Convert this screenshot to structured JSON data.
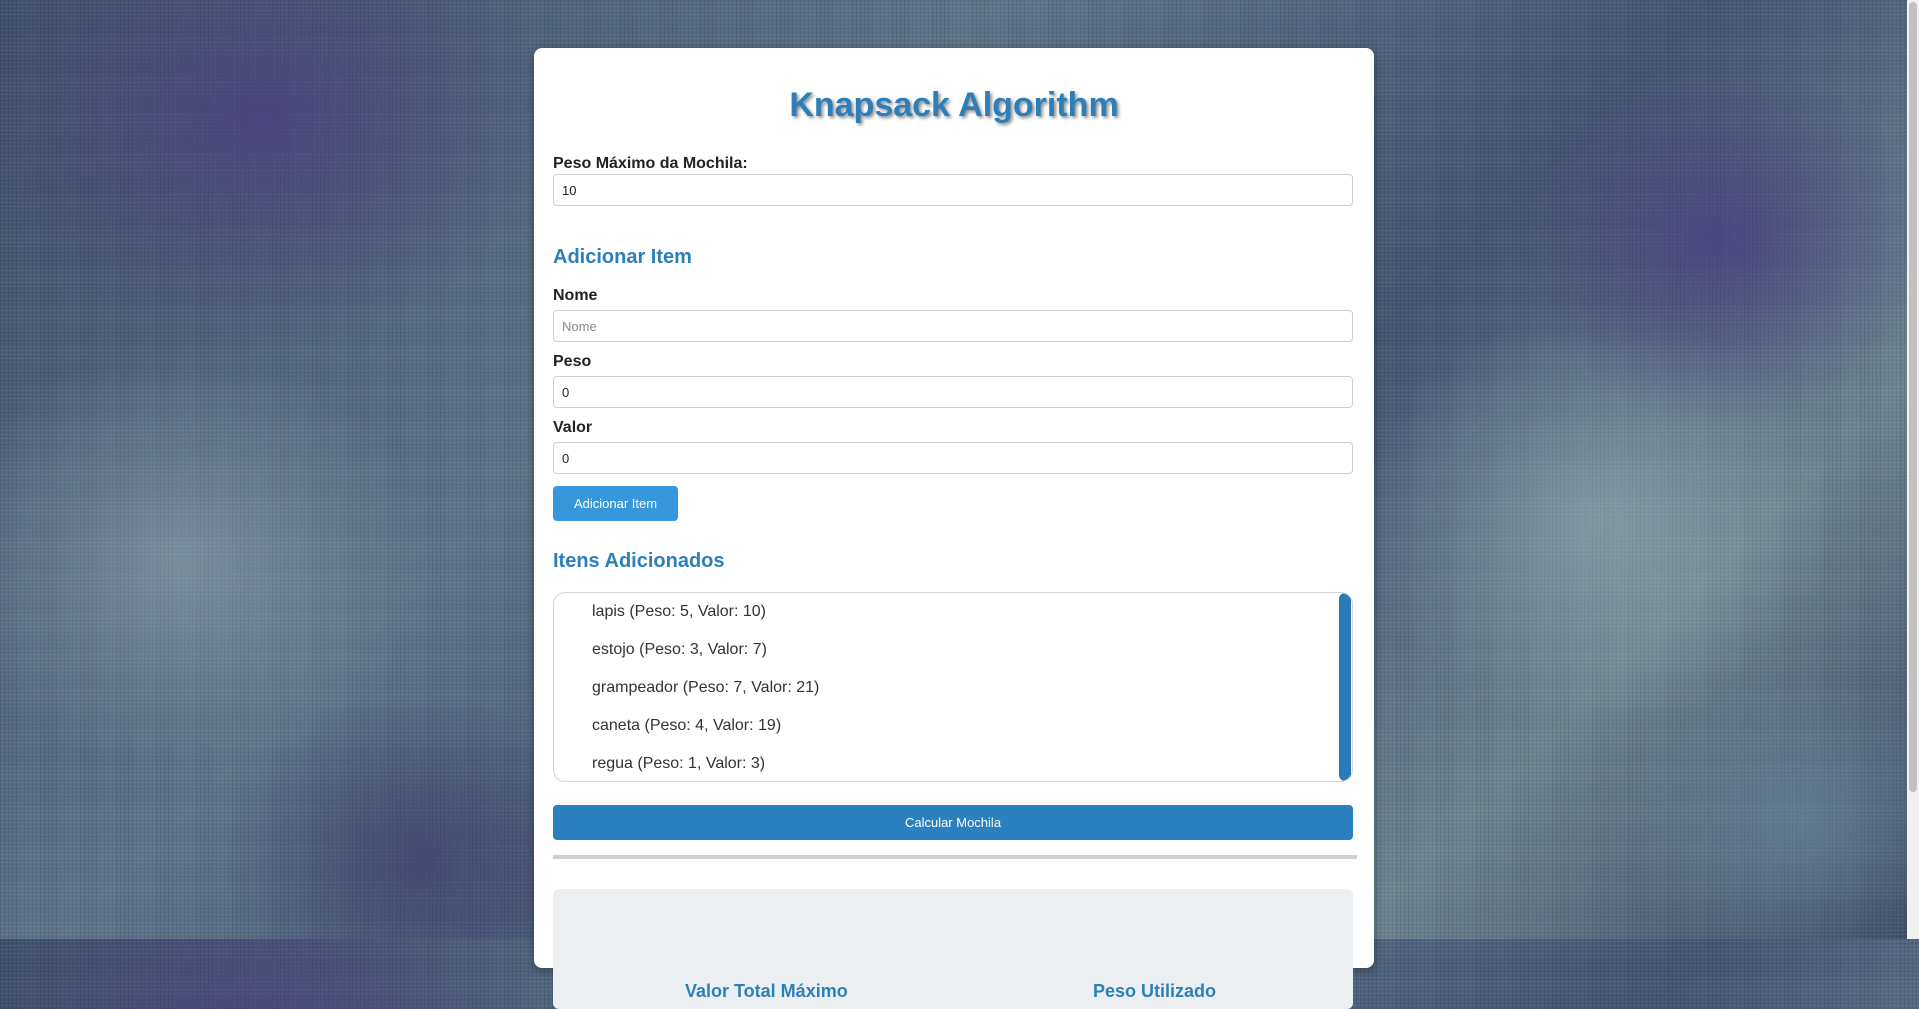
{
  "title": "Knapsack Algorithm",
  "max_weight": {
    "label": "Peso Máximo da Mochila:",
    "value": "10"
  },
  "add_item": {
    "heading": "Adicionar Item",
    "name_label": "Nome",
    "name_placeholder": "Nome",
    "name_value": "",
    "weight_label": "Peso",
    "weight_value": "0",
    "value_label": "Valor",
    "value_value": "0",
    "button_label": "Adicionar Item"
  },
  "items_section": {
    "heading": "Itens Adicionados",
    "items": [
      "lapis (Peso: 5, Valor: 10)",
      "estojo (Peso: 3, Valor: 7)",
      "grampeador (Peso: 7, Valor: 21)",
      "caneta (Peso: 4, Valor: 19)",
      "regua (Peso: 1, Valor: 3)"
    ]
  },
  "calculate_button": "Calcular Mochila",
  "results": {
    "total_value_heading": "Valor Total Máximo",
    "capacity_heading": "Peso Utilizado"
  },
  "colors": {
    "accent": "#2d7fb9",
    "button": "#3498db",
    "calc_button": "#2b80bf"
  }
}
